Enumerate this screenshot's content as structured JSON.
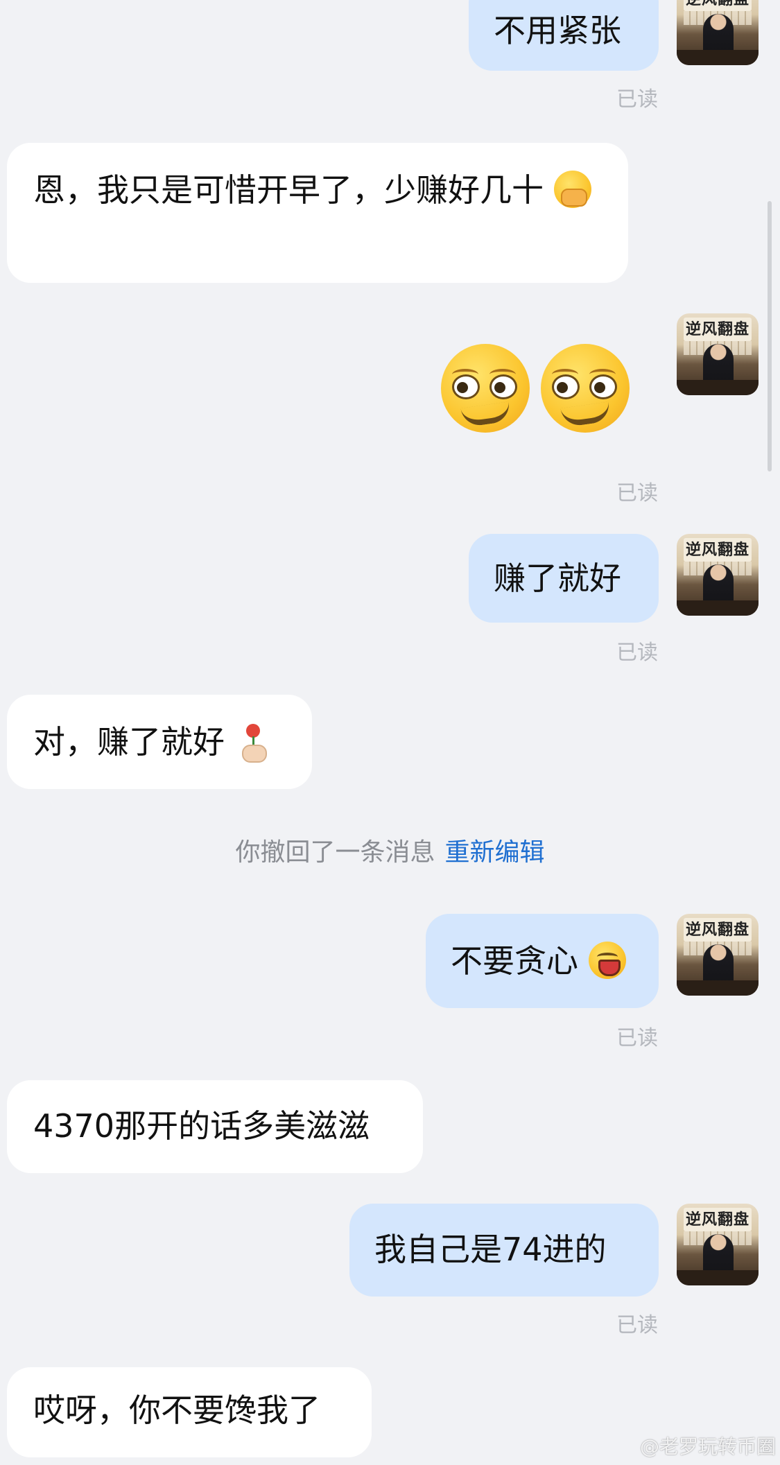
{
  "messages": [
    {
      "side": "out",
      "text": "不用紧张",
      "status": "已读"
    },
    {
      "side": "in",
      "text": "恩，我只是可惜开早了，少赚好几十",
      "emoji": "hand-over-mouth-emoji"
    },
    {
      "side": "out",
      "emoji": "woozy-face-emoji x2",
      "status": "已读"
    },
    {
      "side": "out",
      "text": "赚了就好",
      "status": "已读"
    },
    {
      "side": "in",
      "text": "对，赚了就好",
      "emoji": "flower-in-hand-emoji"
    },
    {
      "side": "out",
      "text": "不要贪心",
      "emoji": "grinning-squinting-face-emoji",
      "status": "已读"
    },
    {
      "side": "in",
      "text": "4370那开的话多美滋滋"
    },
    {
      "side": "out",
      "text": "我自己是74进的",
      "status": "已读"
    },
    {
      "side": "in",
      "text": "哎呀，你不要馋我了"
    }
  ],
  "system": {
    "recall_text": "你撤回了一条消息",
    "reedit_label": "重新编辑"
  },
  "avatar": {
    "calligraphy": "逆风翻盘"
  },
  "watermark": "@老罗玩转币圈",
  "colors": {
    "background": "#f1f2f5",
    "outgoing_bubble": "#d4e6fd",
    "incoming_bubble": "#ffffff",
    "link": "#1f6fd1",
    "read_status": "#b4b7bd"
  }
}
